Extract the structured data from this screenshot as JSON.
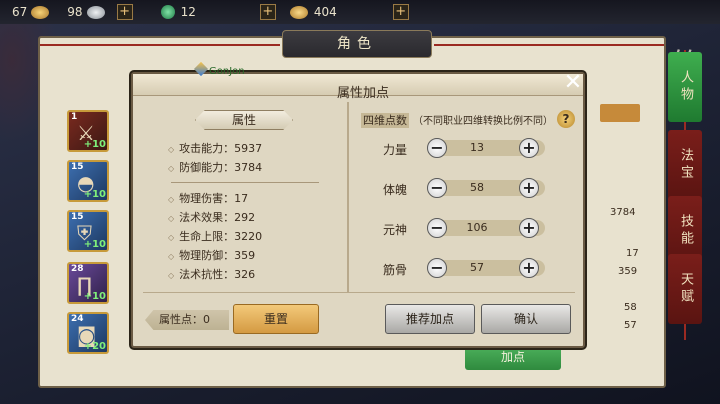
{
  "resources": [
    {
      "icon": "gold-ingot-icon",
      "value": "67"
    },
    {
      "icon": "silver-ingot-icon",
      "value": "98"
    },
    {
      "icon": "jade-icon",
      "value": "12"
    },
    {
      "icon": "gold-coin-icon",
      "value": "404"
    }
  ],
  "panel": {
    "title": "角色",
    "tabs": [
      "人物",
      "法宝",
      "技能",
      "天赋"
    ],
    "active_tab": "人物",
    "add_points_button": "加点",
    "bg_values": [
      "3784",
      "17",
      "359",
      "58",
      "57"
    ]
  },
  "equipment": [
    {
      "level": "1",
      "enhance": "+10",
      "icon": "sword-icon",
      "rarity": "red"
    },
    {
      "level": "15",
      "enhance": "+10",
      "icon": "helmet-icon",
      "rarity": "blue"
    },
    {
      "level": "15",
      "enhance": "+10",
      "icon": "armor-icon",
      "rarity": "blue"
    },
    {
      "level": "28",
      "enhance": "+10",
      "icon": "pants-icon",
      "rarity": "purple"
    },
    {
      "level": "24",
      "enhance": "+20",
      "icon": "boots-icon",
      "rarity": "blue"
    }
  ],
  "dialog": {
    "title": "属性加点",
    "player_name": "GonJon",
    "close_label": "✕",
    "attr_header": "属性",
    "stats_group1": [
      {
        "label": "攻击能力：5937"
      },
      {
        "label": "防御能力：3784"
      }
    ],
    "stats_group2": [
      {
        "label": "物理伤害：17"
      },
      {
        "label": "法术效果：292"
      },
      {
        "label": "生命上限：3220"
      },
      {
        "label": "物理防御：359"
      },
      {
        "label": "法术抗性：326"
      }
    ],
    "four_dim_header": "四维点数",
    "four_dim_note": "（不同职业四维转换比例不同）",
    "help_label": "?",
    "traits": [
      {
        "label": "力量",
        "value": "13"
      },
      {
        "label": "体魄",
        "value": "58"
      },
      {
        "label": "元神",
        "value": "106"
      },
      {
        "label": "筋骨",
        "value": "57"
      }
    ],
    "points_label": "属性点：0",
    "reset_button": "重置",
    "recommend_button": "推荐加点",
    "confirm_button": "确认"
  }
}
